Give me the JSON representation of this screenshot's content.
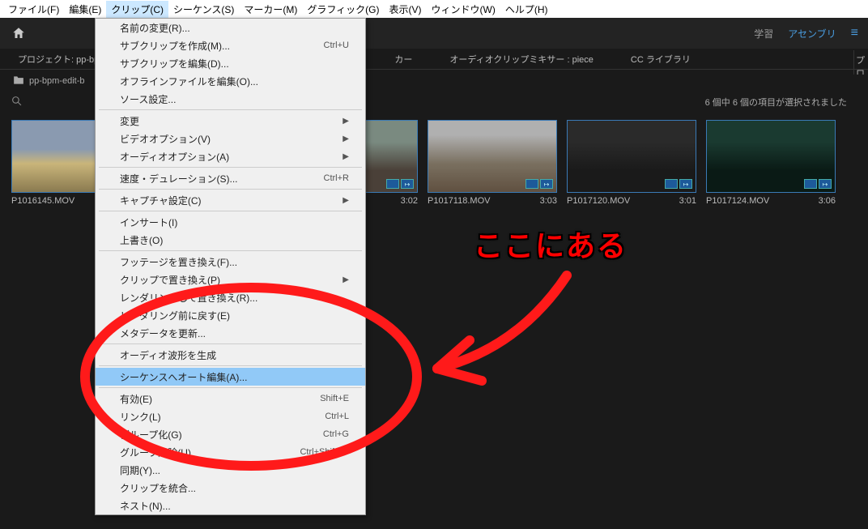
{
  "menubar": [
    {
      "label": "ファイル(F)"
    },
    {
      "label": "編集(E)"
    },
    {
      "label": "クリップ(C)",
      "active": true
    },
    {
      "label": "シーケンス(S)"
    },
    {
      "label": "マーカー(M)"
    },
    {
      "label": "グラフィック(G)"
    },
    {
      "label": "表示(V)"
    },
    {
      "label": "ウィンドウ(W)"
    },
    {
      "label": "ヘルプ(H)"
    }
  ],
  "toolbar": {
    "learn": "学習",
    "assembly": "アセンブリ"
  },
  "panel_tabs": {
    "project": "プロジェクト: pp-bpm",
    "marker": "カー",
    "audio_mixer": "オーディオクリップミキサー  : piece",
    "cc_library": "CC ライブラリ",
    "right_proj": "プロ"
  },
  "breadcrumb": "pp-bpm-edit-b",
  "selection_info": "6 個中 6 個の項目が選択されました",
  "thumbnails": [
    {
      "name": "P1016145.MOV",
      "dur": ""
    },
    {
      "name": "",
      "dur": "3:02"
    },
    {
      "name": "P1017118.MOV",
      "dur": "3:03"
    },
    {
      "name": "P1017120.MOV",
      "dur": "3:01"
    },
    {
      "name": "P1017124.MOV",
      "dur": "3:06"
    }
  ],
  "dropdown": [
    {
      "label": "名前の変更(R)..."
    },
    {
      "label": "サブクリップを作成(M)...",
      "shortcut": "Ctrl+U"
    },
    {
      "label": "サブクリップを編集(D)..."
    },
    {
      "label": "オフラインファイルを編集(O)..."
    },
    {
      "label": "ソース設定..."
    },
    {
      "sep": true
    },
    {
      "label": "変更",
      "sub": true
    },
    {
      "label": "ビデオオプション(V)",
      "sub": true
    },
    {
      "label": "オーディオオプション(A)",
      "sub": true
    },
    {
      "sep": true
    },
    {
      "label": "速度・デュレーション(S)...",
      "shortcut": "Ctrl+R"
    },
    {
      "sep": true
    },
    {
      "label": "キャプチャ設定(C)",
      "sub": true
    },
    {
      "sep": true
    },
    {
      "label": "インサート(I)"
    },
    {
      "label": "上書き(O)"
    },
    {
      "sep": true
    },
    {
      "label": "フッテージを置き換え(F)..."
    },
    {
      "label": "クリップで置き換え(P)",
      "sub": true
    },
    {
      "label": "レンダリングして置き換え(R)..."
    },
    {
      "label": "レンダリング前に戻す(E)"
    },
    {
      "label": "メタデータを更新..."
    },
    {
      "sep": true
    },
    {
      "label": "オーディオ波形を生成"
    },
    {
      "sep": true
    },
    {
      "label": "シーケンスへオート編集(A)...",
      "highlighted": true
    },
    {
      "sep": true
    },
    {
      "label": "有効(E)",
      "shortcut": "Shift+E"
    },
    {
      "label": "リンク(L)",
      "shortcut": "Ctrl+L"
    },
    {
      "label": "グループ化(G)",
      "shortcut": "Ctrl+G"
    },
    {
      "label": "グループ解除(U)",
      "shortcut": "Ctrl+Shift+G"
    },
    {
      "label": "同期(Y)..."
    },
    {
      "label": "クリップを統合..."
    },
    {
      "label": "ネスト(N)..."
    }
  ],
  "annotation": {
    "text": "ここにある"
  }
}
